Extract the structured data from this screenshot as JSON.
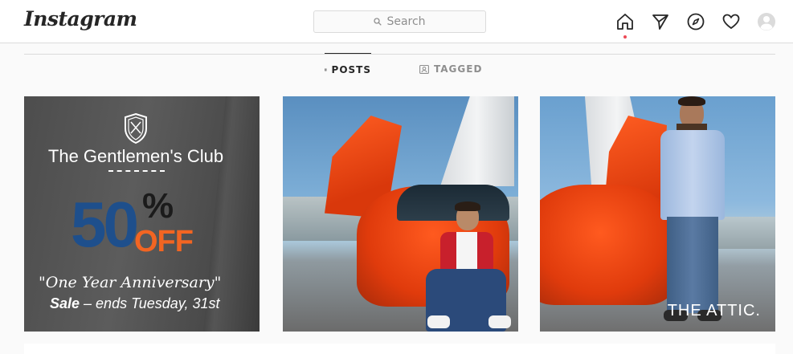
{
  "app": {
    "logo": "Instagram"
  },
  "search": {
    "placeholder": "Search"
  },
  "nav": {
    "icons": [
      "home-icon",
      "direct-icon",
      "explore-icon",
      "activity-icon",
      "profile-avatar"
    ],
    "notification_color": "#ed4956"
  },
  "tabs": [
    {
      "label": "POSTS",
      "icon": "grid-icon",
      "active": true
    },
    {
      "label": "TAGGED",
      "icon": "tagged-icon",
      "active": false
    }
  ],
  "posts": [
    {
      "title": "The Gentlemen's Club",
      "discount_number": "50",
      "discount_percent": "%",
      "discount_off": "OFF",
      "tagline": "\"One Year Anniversary\"",
      "sale_word": "Sale",
      "sale_rest": " – ends Tuesday, 31st",
      "brand_colors": {
        "blue": "#1e4f8c",
        "orange": "#f26522"
      }
    },
    {
      "caption": ""
    },
    {
      "watermark": "THE ATTIC."
    }
  ]
}
